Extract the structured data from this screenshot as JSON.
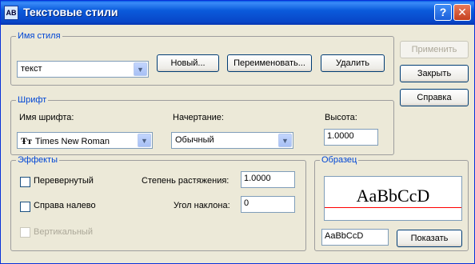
{
  "window": {
    "title": "Текстовые стили",
    "app_icon": "AB",
    "help_glyph": "?",
    "close_glyph": "✕"
  },
  "style_name": {
    "legend": "Имя стиля",
    "selected": "текст",
    "new_label": "Новый...",
    "rename_label": "Переименовать...",
    "delete_label": "Удалить"
  },
  "side_buttons": {
    "apply_label": "Применить",
    "close_label": "Закрыть",
    "help_label": "Справка"
  },
  "font": {
    "legend": "Шрифт",
    "font_name_label": "Имя шрифта:",
    "font_icon": "Ŧт",
    "font_name_value": "Times New Roman",
    "style_label": "Начертание:",
    "style_value": "Обычный",
    "height_label": "Высота:",
    "height_value": "1.0000"
  },
  "effects": {
    "legend": "Эффекты",
    "upside_down_label": "Перевернутый",
    "backwards_label": "Справа налево",
    "vertical_label": "Вертикальный",
    "width_factor_label": "Степень растяжения:",
    "width_factor_value": "1.0000",
    "oblique_label": "Угол наклона:",
    "oblique_value": "0"
  },
  "preview": {
    "legend": "Образец",
    "sample_text": "AaBbCcD",
    "preview_input_value": "AaBbCcD",
    "show_label": "Показать"
  }
}
